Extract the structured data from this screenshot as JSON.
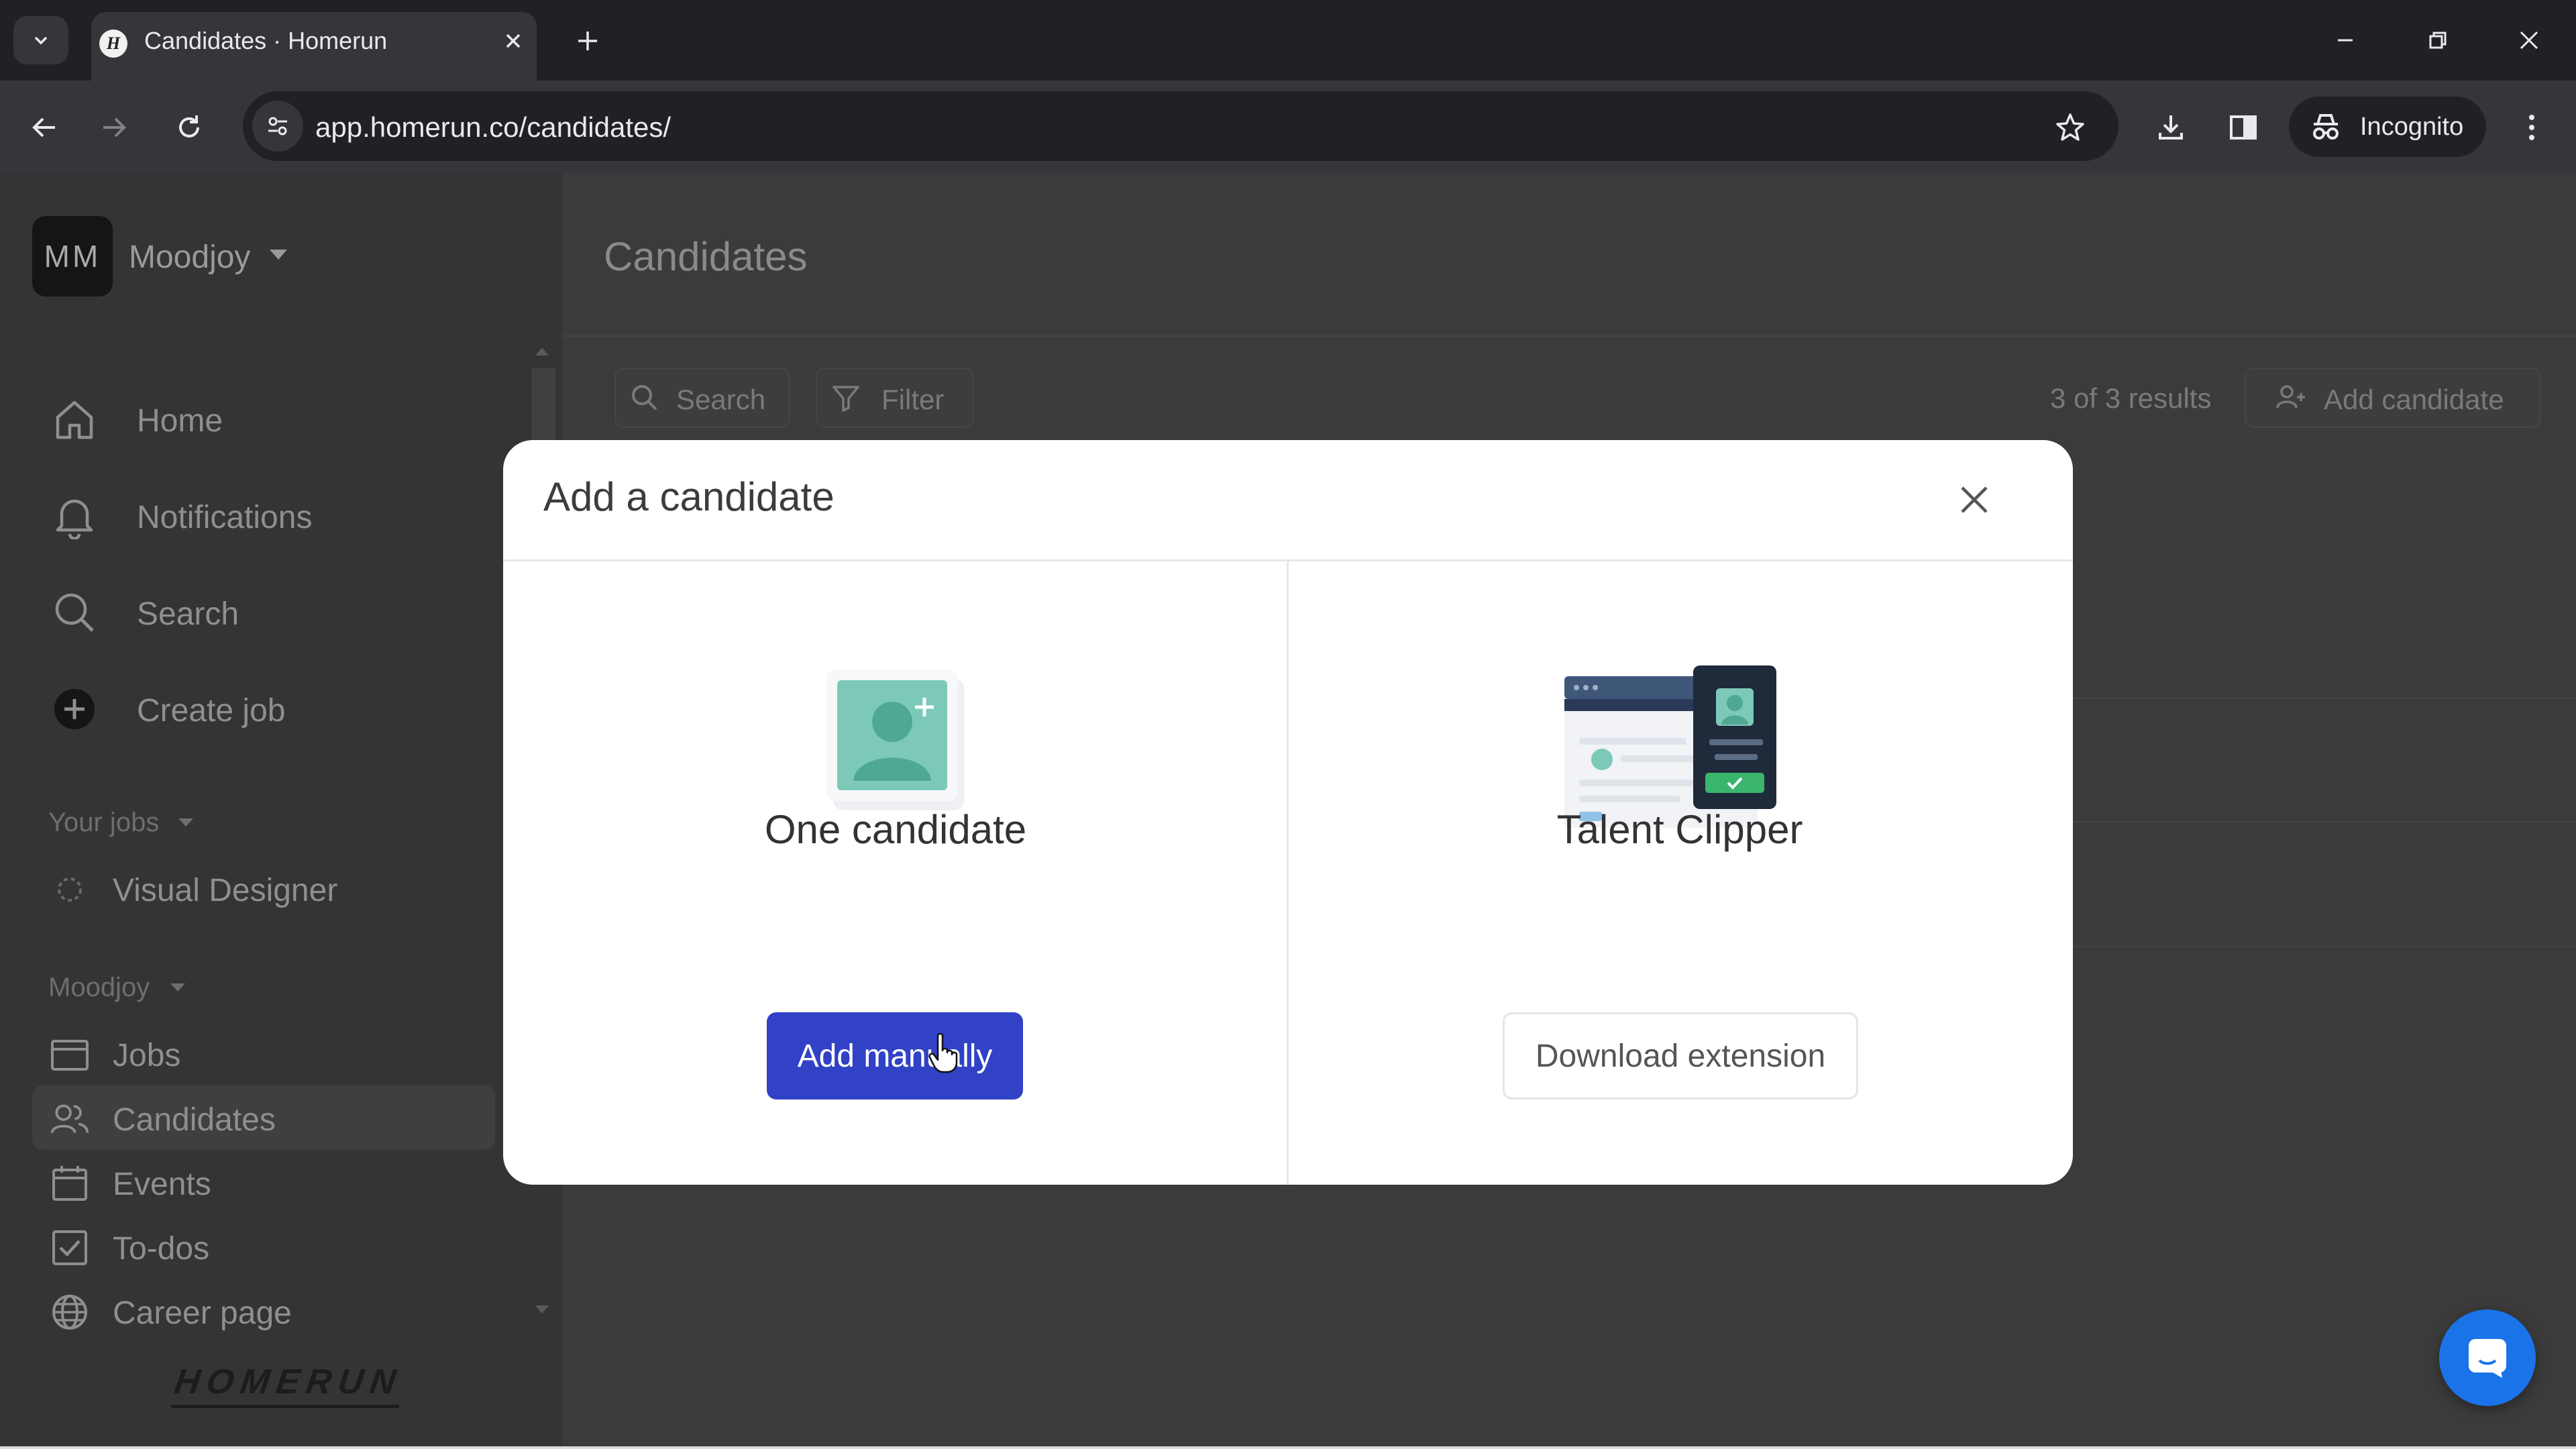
{
  "browser": {
    "tab_title": "Candidates · Homerun",
    "favicon_letter": "H",
    "url": "app.homerun.co/candidates/",
    "profile_label": "Incognito"
  },
  "sidebar": {
    "org_initials": "MM",
    "org_name": "Moodjoy",
    "primary_nav": [
      {
        "label": "Home",
        "icon": "home-icon"
      },
      {
        "label": "Notifications",
        "icon": "bell-icon"
      },
      {
        "label": "Search",
        "icon": "search-icon"
      },
      {
        "label": "Create job",
        "icon": "plus-circle-icon"
      }
    ],
    "your_jobs_label": "Your jobs",
    "jobs": [
      {
        "label": "Visual Designer",
        "icon": "draft-status-icon"
      }
    ],
    "workspace_label": "Moodjoy",
    "workspace_nav": [
      {
        "label": "Jobs",
        "icon": "briefcase-icon"
      },
      {
        "label": "Candidates",
        "icon": "people-icon",
        "active": true
      },
      {
        "label": "Events",
        "icon": "calendar-icon"
      },
      {
        "label": "To-dos",
        "icon": "checkbox-icon"
      },
      {
        "label": "Career page",
        "icon": "globe-icon"
      }
    ],
    "brand_logo": "HOMERUN"
  },
  "main": {
    "page_title": "Candidates",
    "search_label": "Search",
    "filter_label": "Filter",
    "results_text": "3 of 3 results",
    "add_candidate_label": "Add candidate"
  },
  "modal": {
    "title": "Add a candidate",
    "options": [
      {
        "title": "One candidate",
        "button": "Add manually",
        "illustration": "person-card-illustration"
      },
      {
        "title": "Talent Clipper",
        "button": "Download extension",
        "illustration": "browser-extension-illustration"
      }
    ]
  },
  "colors": {
    "primary_button": "#3142c6",
    "overlay": "#3b3b3b",
    "chat_button": "#1a73e8"
  }
}
